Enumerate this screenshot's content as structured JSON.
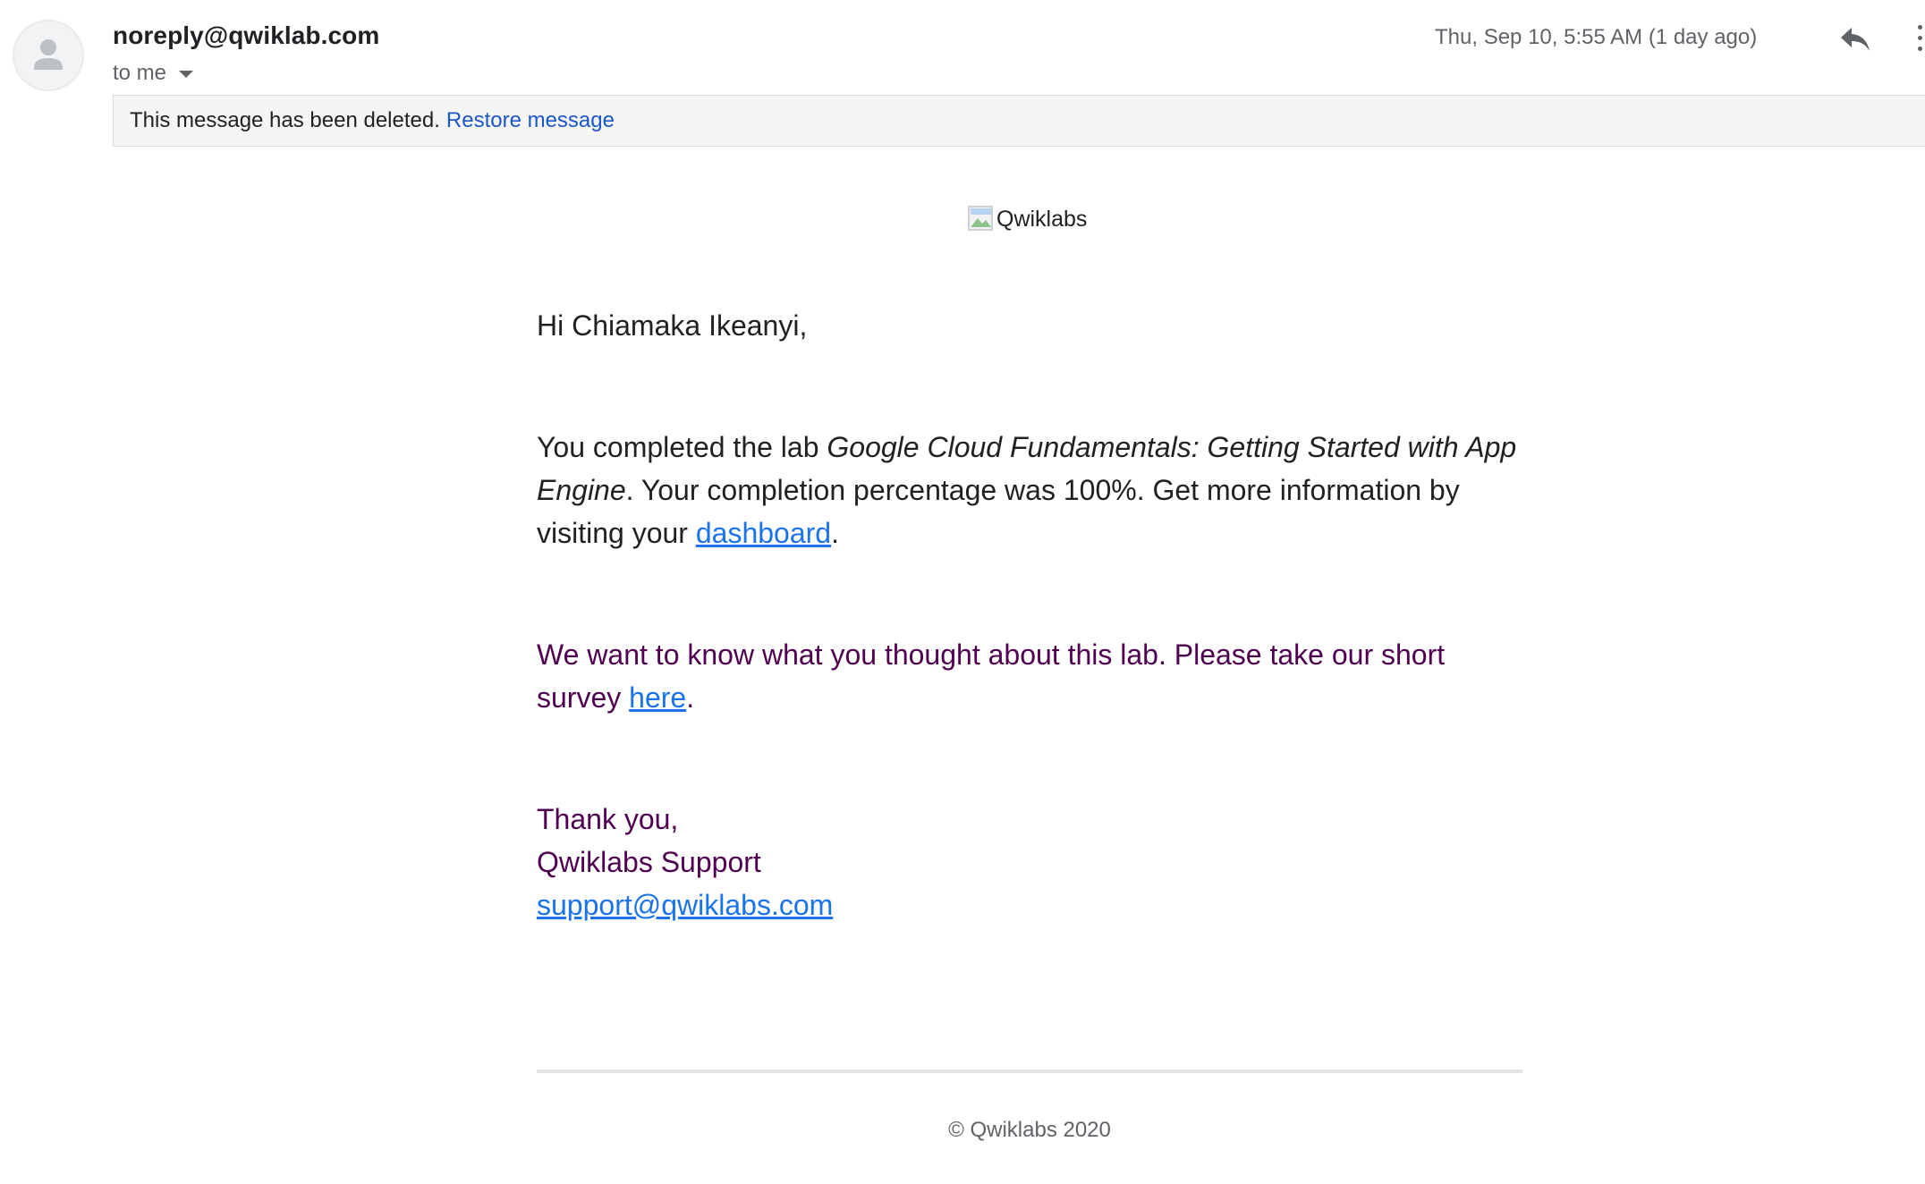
{
  "header": {
    "sender": "noreply@qwiklab.com",
    "recipient_label": "to me",
    "date": "Thu, Sep 10, 5:55 AM (1 day ago)",
    "icons": {
      "avatar": "default-avatar-icon",
      "reply": "reply-icon",
      "more": "more-vert-icon"
    }
  },
  "banner": {
    "text": "This message has been deleted.",
    "restore_label": "Restore message"
  },
  "email": {
    "logo_alt": "Qwiklabs",
    "greeting": "Hi Chiamaka Ikeanyi,",
    "para1_prefix": "You completed the lab ",
    "para1_lab": "Google Cloud Fundamentals: Getting Started with App Engine",
    "para1_middle": ". Your completion percentage was 100%. Get more information by visiting your ",
    "para1_link": "dashboard",
    "para1_suffix": ".",
    "para2_prefix": "We want to know what you thought about this lab. Please take our short survey ",
    "para2_link": "here",
    "para2_suffix": ".",
    "signoff_line1": "Thank you,",
    "signoff_line2": "Qwiklabs Support",
    "support_email": "support@qwiklabs.com",
    "copyright": "© Qwiklabs 2020"
  },
  "colors": {
    "link": "#1a73e8",
    "restore_link": "#1a57c8",
    "quoted_text": "#500050",
    "banner_bg": "#f5f5f5"
  }
}
